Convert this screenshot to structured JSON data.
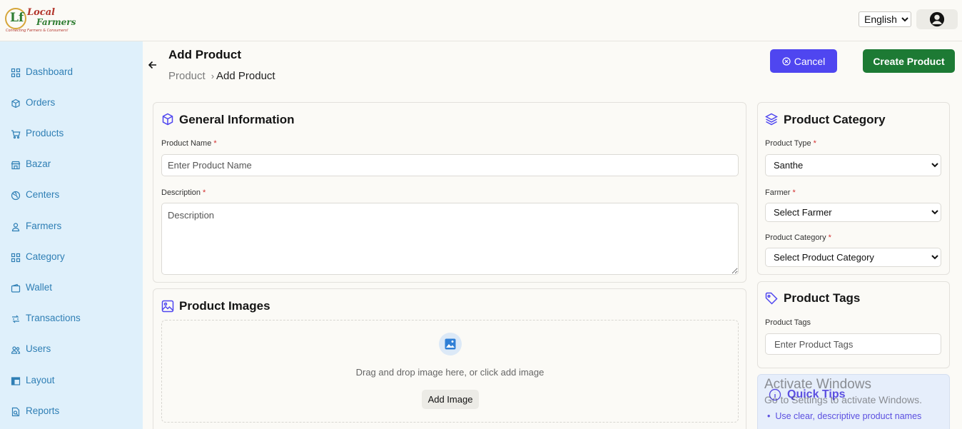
{
  "header": {
    "logo": {
      "line1": "Local",
      "line2": "Farmers",
      "tagline": "Connecting Farmers & Consumers!"
    },
    "language": {
      "selected": "English",
      "options": [
        "English"
      ]
    }
  },
  "sidebar": {
    "items": [
      {
        "label": "Dashboard",
        "icon": "grid-icon"
      },
      {
        "label": "Orders",
        "icon": "box-icon"
      },
      {
        "label": "Products",
        "icon": "cart-icon"
      },
      {
        "label": "Bazar",
        "icon": "store-icon"
      },
      {
        "label": "Centers",
        "icon": "globe-icon"
      },
      {
        "label": "Farmers",
        "icon": "user-icon"
      },
      {
        "label": "Category",
        "icon": "grid-icon"
      },
      {
        "label": "Wallet",
        "icon": "wallet-icon"
      },
      {
        "label": "Transactions",
        "icon": "transfer-icon"
      },
      {
        "label": "Users",
        "icon": "users-icon"
      },
      {
        "label": "Layout",
        "icon": "layout-icon"
      },
      {
        "label": "Reports",
        "icon": "report-icon"
      }
    ]
  },
  "page": {
    "title": "Add Product",
    "breadcrumb": {
      "root": "Product",
      "separator": "›",
      "current": "Add Product"
    },
    "cancel_label": "Cancel",
    "create_label": "Create Product"
  },
  "general": {
    "title": "General Information",
    "product_name": {
      "label": "Product Name",
      "required": "*",
      "placeholder": "Enter Product Name"
    },
    "description": {
      "label": "Description",
      "required": "*",
      "placeholder": "Description"
    }
  },
  "images": {
    "title": "Product Images",
    "drop_text": "Drag and drop image here, or click add image",
    "add_label": "Add Image"
  },
  "category": {
    "title": "Product Category",
    "product_type": {
      "label": "Product Type",
      "required": "*",
      "selected": "Santhe"
    },
    "farmer": {
      "label": "Farmer",
      "required": "*",
      "selected": "Select Farmer"
    },
    "product_category": {
      "label": "Product Category",
      "required": "*",
      "selected": "Select Product Category"
    }
  },
  "tags": {
    "title": "Product Tags",
    "label": "Product Tags",
    "placeholder": "Enter Product Tags"
  },
  "tips": {
    "title": "Quick Tips",
    "items": [
      "Use clear, descriptive product names"
    ]
  },
  "watermark": {
    "line1": "Activate Windows",
    "line2": "Go to Settings to activate Windows."
  },
  "colors": {
    "sidebar_bg": "#dff0fb",
    "sidebar_text": "#2f7fb5",
    "accent_purple": "#4f46f0",
    "accent_green": "#1d7a34",
    "required": "#d32f2f"
  }
}
